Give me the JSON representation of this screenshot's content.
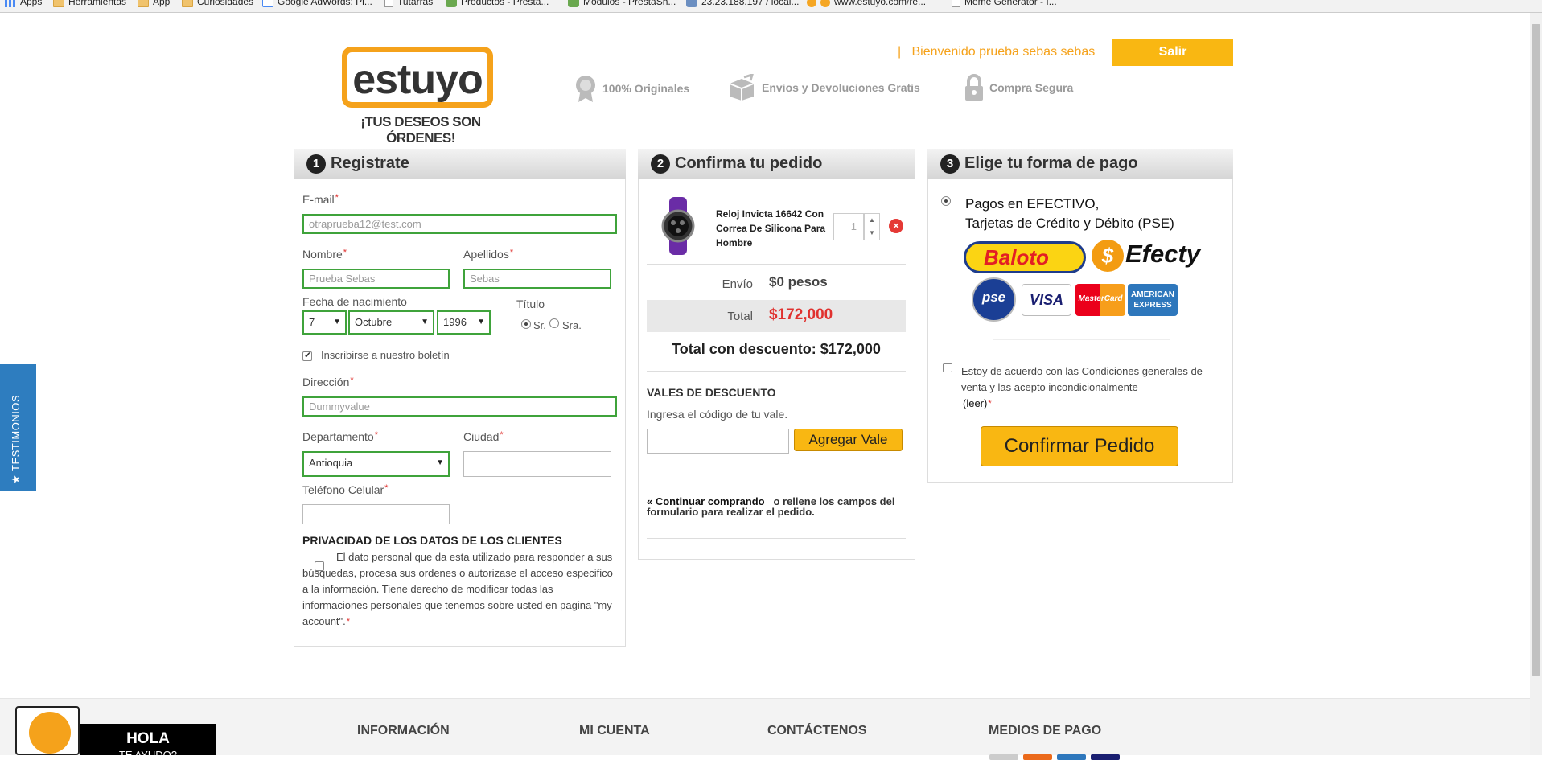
{
  "bookmarks": [
    {
      "label": "Apps",
      "icon": "apps-grid-icon"
    },
    {
      "label": "Herramientas",
      "icon": "folder-icon"
    },
    {
      "label": "App",
      "icon": "folder-icon"
    },
    {
      "label": "Curiosidades",
      "icon": "folder-icon"
    },
    {
      "label": "Google AdWords: Pl...",
      "icon": "google-icon"
    },
    {
      "label": "Tutarras",
      "icon": "page-icon"
    },
    {
      "label": "Productos - Presta...",
      "icon": "puzzle-icon"
    },
    {
      "label": "Módulos - PrestaSh...",
      "icon": "puzzle-icon"
    },
    {
      "label": "23.23.188.197 / local...",
      "icon": "pma-icon"
    },
    {
      "label": "www.estuyo.com/re...",
      "icon": "estuyo-icon"
    },
    {
      "label": "Meme Generator - I...",
      "icon": "page-icon"
    }
  ],
  "header": {
    "logo_text": "estuyo",
    "tagline": "¡TUS DESEOS SON ÓRDENES!",
    "features": [
      "100% Originales",
      "Envios y Devoluciones Gratis",
      "Compra Segura"
    ],
    "welcome_sep": "|",
    "welcome": "Bienvenido prueba sebas sebas",
    "logout_label": "Salir",
    "brand_color": "#f5a21b"
  },
  "register": {
    "step": "1",
    "title": "Registrate",
    "email_label": "E-mail",
    "email_value": "otraprueba12@test.com",
    "nombre_label": "Nombre",
    "nombre_value": "Prueba Sebas",
    "apellidos_label": "Apellidos",
    "apellidos_value": "Sebas",
    "birth_label": "Fecha de nacimiento",
    "birth_day": "7",
    "birth_month": "Octubre",
    "birth_year": "1996",
    "titulo_label": "Título",
    "titulo_sr": "Sr.",
    "titulo_sra": "Sra.",
    "newsletter_label": "Inscribirse a nuestro boletín",
    "direccion_label": "Dirección",
    "direccion_value": "Dummyvalue",
    "departamento_label": "Departamento",
    "departamento_value": "Antioquia",
    "ciudad_label": "Ciudad",
    "telefono_label": "Teléfono Celular",
    "privacy_title": "PRIVACIDAD DE LOS DATOS DE LOS CLIENTES",
    "privacy_text": "El dato personal que da esta utilizado para responder a sus búsquedas, procesa sus ordenes o autorizase el acceso especifico a la información. Tiene derecho de modificar todas las informaciones personales que tenemos sobre usted en pagina \"my account\"."
  },
  "order": {
    "step": "2",
    "title": "Confirma tu pedido",
    "product_name": "Reloj Invicta 16642 Con Correa De Silicona Para Hombre",
    "quantity": "1",
    "envio_label": "Envío",
    "envio_value": "$0 pesos",
    "total_label": "Total",
    "total_value": "$172,000",
    "grand_total": "Total con descuento: $172,000",
    "vales_title": "VALES DE DESCUENTO",
    "vales_sub": "Ingresa el código de tu vale.",
    "vale_button": "Agregar Vale",
    "continuar_link": "« Continuar comprando",
    "continuar_rest": "o rellene los campos del formulario para realizar el pedido."
  },
  "payment": {
    "step": "3",
    "title": "Elige tu forma de pago",
    "option_line1": "Pagos en EFECTIVO,",
    "option_line2": "Tarjetas de Crédito y Débito (PSE)",
    "logos": {
      "baloto": "Baloto",
      "efecty": "Efecty",
      "pse": "pse",
      "visa": "VISA",
      "mastercard": "MasterCard",
      "amex": "AMERICAN EXPRESS"
    },
    "terms_text": "Estoy de acuerdo con las Condiciones generales de venta y las acepto incondicionalmente",
    "terms_link": "(leer)",
    "confirm_button": "Confirmar Pedido"
  },
  "sidebar_tab": "★ TESTIMONIOS",
  "footer": {
    "help_line1": "HOLA",
    "help_line2": "TE AYUDO?",
    "columns": [
      "INFORMACIÓN",
      "MI CUENTA",
      "CONTÁCTENOS",
      "MEDIOS DE PAGO"
    ]
  }
}
